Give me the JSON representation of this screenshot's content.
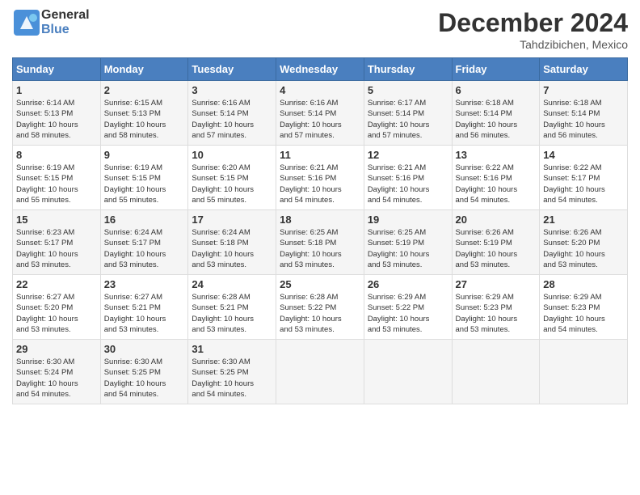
{
  "header": {
    "logo_line1": "General",
    "logo_line2": "Blue",
    "month": "December 2024",
    "location": "Tahdzibichen, Mexico"
  },
  "days_of_week": [
    "Sunday",
    "Monday",
    "Tuesday",
    "Wednesday",
    "Thursday",
    "Friday",
    "Saturday"
  ],
  "weeks": [
    [
      {
        "day": "1",
        "info": "Sunrise: 6:14 AM\nSunset: 5:13 PM\nDaylight: 10 hours\nand 58 minutes."
      },
      {
        "day": "2",
        "info": "Sunrise: 6:15 AM\nSunset: 5:13 PM\nDaylight: 10 hours\nand 58 minutes."
      },
      {
        "day": "3",
        "info": "Sunrise: 6:16 AM\nSunset: 5:14 PM\nDaylight: 10 hours\nand 57 minutes."
      },
      {
        "day": "4",
        "info": "Sunrise: 6:16 AM\nSunset: 5:14 PM\nDaylight: 10 hours\nand 57 minutes."
      },
      {
        "day": "5",
        "info": "Sunrise: 6:17 AM\nSunset: 5:14 PM\nDaylight: 10 hours\nand 57 minutes."
      },
      {
        "day": "6",
        "info": "Sunrise: 6:18 AM\nSunset: 5:14 PM\nDaylight: 10 hours\nand 56 minutes."
      },
      {
        "day": "7",
        "info": "Sunrise: 6:18 AM\nSunset: 5:14 PM\nDaylight: 10 hours\nand 56 minutes."
      }
    ],
    [
      {
        "day": "8",
        "info": "Sunrise: 6:19 AM\nSunset: 5:15 PM\nDaylight: 10 hours\nand 55 minutes."
      },
      {
        "day": "9",
        "info": "Sunrise: 6:19 AM\nSunset: 5:15 PM\nDaylight: 10 hours\nand 55 minutes."
      },
      {
        "day": "10",
        "info": "Sunrise: 6:20 AM\nSunset: 5:15 PM\nDaylight: 10 hours\nand 55 minutes."
      },
      {
        "day": "11",
        "info": "Sunrise: 6:21 AM\nSunset: 5:16 PM\nDaylight: 10 hours\nand 54 minutes."
      },
      {
        "day": "12",
        "info": "Sunrise: 6:21 AM\nSunset: 5:16 PM\nDaylight: 10 hours\nand 54 minutes."
      },
      {
        "day": "13",
        "info": "Sunrise: 6:22 AM\nSunset: 5:16 PM\nDaylight: 10 hours\nand 54 minutes."
      },
      {
        "day": "14",
        "info": "Sunrise: 6:22 AM\nSunset: 5:17 PM\nDaylight: 10 hours\nand 54 minutes."
      }
    ],
    [
      {
        "day": "15",
        "info": "Sunrise: 6:23 AM\nSunset: 5:17 PM\nDaylight: 10 hours\nand 53 minutes."
      },
      {
        "day": "16",
        "info": "Sunrise: 6:24 AM\nSunset: 5:17 PM\nDaylight: 10 hours\nand 53 minutes."
      },
      {
        "day": "17",
        "info": "Sunrise: 6:24 AM\nSunset: 5:18 PM\nDaylight: 10 hours\nand 53 minutes."
      },
      {
        "day": "18",
        "info": "Sunrise: 6:25 AM\nSunset: 5:18 PM\nDaylight: 10 hours\nand 53 minutes."
      },
      {
        "day": "19",
        "info": "Sunrise: 6:25 AM\nSunset: 5:19 PM\nDaylight: 10 hours\nand 53 minutes."
      },
      {
        "day": "20",
        "info": "Sunrise: 6:26 AM\nSunset: 5:19 PM\nDaylight: 10 hours\nand 53 minutes."
      },
      {
        "day": "21",
        "info": "Sunrise: 6:26 AM\nSunset: 5:20 PM\nDaylight: 10 hours\nand 53 minutes."
      }
    ],
    [
      {
        "day": "22",
        "info": "Sunrise: 6:27 AM\nSunset: 5:20 PM\nDaylight: 10 hours\nand 53 minutes."
      },
      {
        "day": "23",
        "info": "Sunrise: 6:27 AM\nSunset: 5:21 PM\nDaylight: 10 hours\nand 53 minutes."
      },
      {
        "day": "24",
        "info": "Sunrise: 6:28 AM\nSunset: 5:21 PM\nDaylight: 10 hours\nand 53 minutes."
      },
      {
        "day": "25",
        "info": "Sunrise: 6:28 AM\nSunset: 5:22 PM\nDaylight: 10 hours\nand 53 minutes."
      },
      {
        "day": "26",
        "info": "Sunrise: 6:29 AM\nSunset: 5:22 PM\nDaylight: 10 hours\nand 53 minutes."
      },
      {
        "day": "27",
        "info": "Sunrise: 6:29 AM\nSunset: 5:23 PM\nDaylight: 10 hours\nand 53 minutes."
      },
      {
        "day": "28",
        "info": "Sunrise: 6:29 AM\nSunset: 5:23 PM\nDaylight: 10 hours\nand 54 minutes."
      }
    ],
    [
      {
        "day": "29",
        "info": "Sunrise: 6:30 AM\nSunset: 5:24 PM\nDaylight: 10 hours\nand 54 minutes."
      },
      {
        "day": "30",
        "info": "Sunrise: 6:30 AM\nSunset: 5:25 PM\nDaylight: 10 hours\nand 54 minutes."
      },
      {
        "day": "31",
        "info": "Sunrise: 6:30 AM\nSunset: 5:25 PM\nDaylight: 10 hours\nand 54 minutes."
      },
      {
        "day": "",
        "info": ""
      },
      {
        "day": "",
        "info": ""
      },
      {
        "day": "",
        "info": ""
      },
      {
        "day": "",
        "info": ""
      }
    ]
  ]
}
